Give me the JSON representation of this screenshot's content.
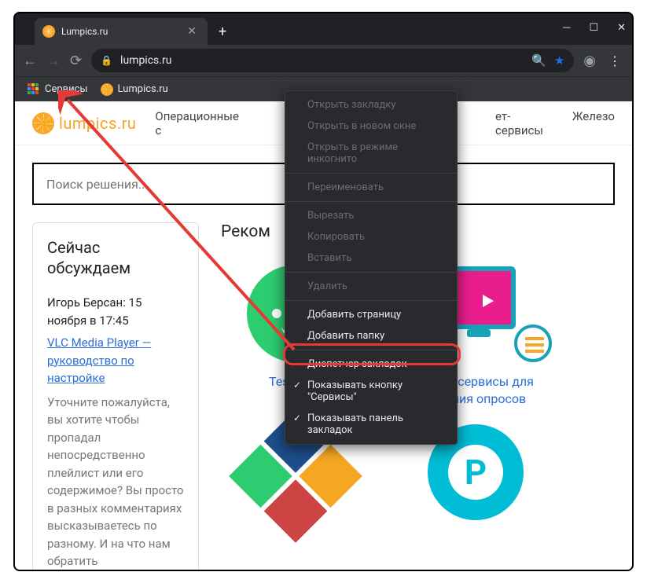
{
  "tab": {
    "title": "Lumpics.ru"
  },
  "url": "lumpics.ru",
  "bookmarks": {
    "services": "Сервисы",
    "lumpics": "Lumpics.ru"
  },
  "site": {
    "logo": "lumpics.ru",
    "nav": {
      "os": "Операционные с",
      "net": "ет-сервисы",
      "hw": "Железо"
    },
    "search_placeholder": "Поиск решения...",
    "discuss_title": "Сейчас обсуждаем",
    "comment": {
      "meta": "Игорь Берсан: 15 ноября в 17:45",
      "link": "VLC Media Player — руководство по настройке",
      "body": "Уточните пожалуйста, вы хотите чтобы пропадал непосредственно плейлист или его содержимое? Вы просто в разных комментариях высказываетесь по разному. И на что нам обратить"
    },
    "rec_title": "Реком",
    "rec1": "Testograf",
    "rec2": "Онлайн-сервисы для создания опросов",
    "p_letter": "P"
  },
  "ctx": {
    "open_tab": "Открыть закладку",
    "open_win": "Открыть в новом окне",
    "open_incog": "Открыть в режиме инкогнито",
    "rename": "Переименовать",
    "cut": "Вырезать",
    "copy": "Копировать",
    "paste": "Вставить",
    "delete": "Удалить",
    "add_page": "Добавить страницу",
    "add_folder": "Добавить папку",
    "manager": "Диспетчер закладок",
    "show_services": "Показывать кнопку \"Сервисы\"",
    "show_bar": "Показывать панель закладок"
  }
}
